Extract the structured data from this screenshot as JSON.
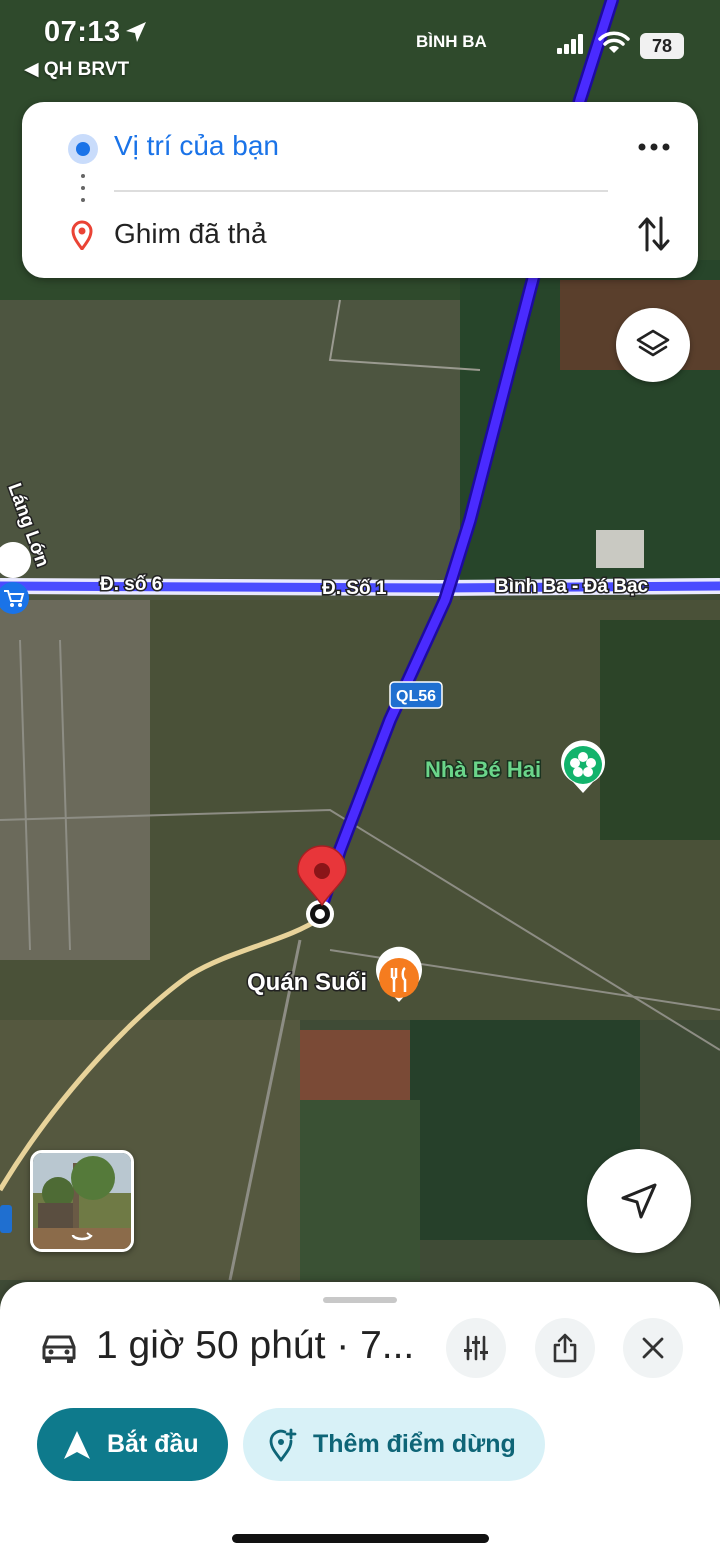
{
  "status_bar": {
    "time": "07:13",
    "back_app": "◀ QH BRVT",
    "battery": "78",
    "icons": [
      "location-arrow-icon",
      "signal-icon",
      "wifi-icon",
      "battery-icon"
    ]
  },
  "route": {
    "origin": "Vị trí của bạn",
    "destination": "Ghim đã thả",
    "origin_color": "#1a73e8",
    "destination_color": "#ea4335"
  },
  "map": {
    "area_label": "BÌNH BA",
    "street_labels": {
      "lang_lon": "Láng Lớn",
      "road_so6": "Đ. số 6",
      "road_so1": "Đ. Số 1",
      "road_binhba": "Bình Ba - Đá Bạc",
      "highway_badge": "QL56"
    },
    "poi": {
      "nursery": "Nhà Bé Hai",
      "restaurant": "Quán Suối"
    },
    "route_color": "#4a2bff"
  },
  "sheet": {
    "duration": "1 giờ 50 phút · 7...",
    "start_label": "Bắt đầu",
    "add_stop_label": "Thêm điểm dừng",
    "accent": "#0e7a8c"
  }
}
